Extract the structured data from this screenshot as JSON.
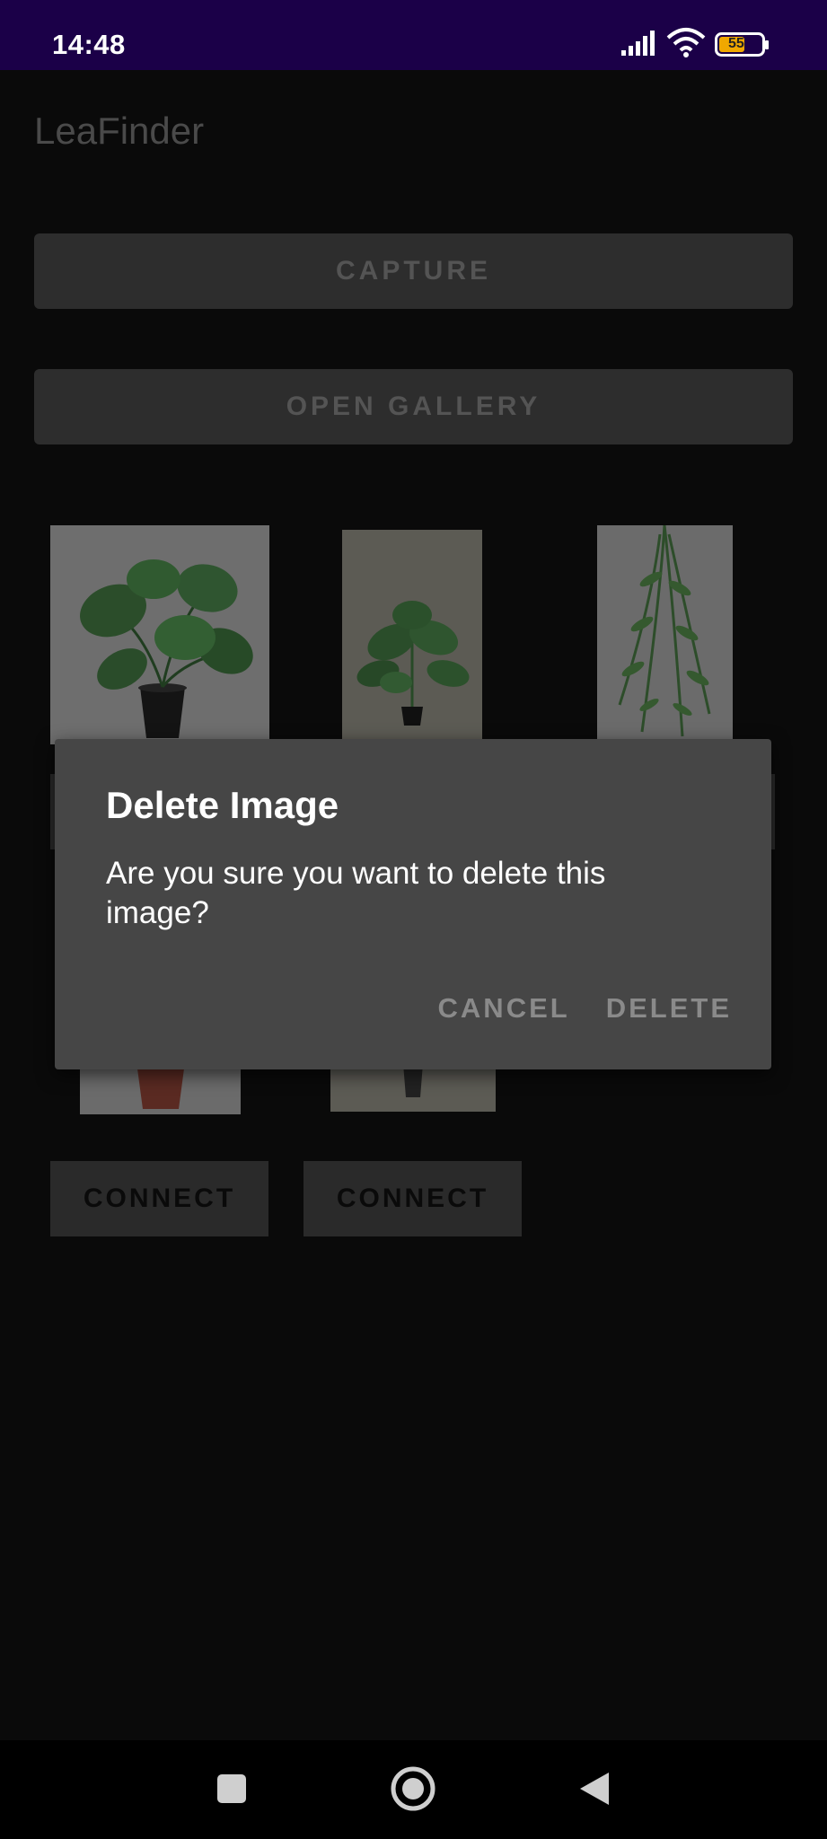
{
  "status_bar": {
    "time": "14:48",
    "battery": "55",
    "icons": [
      "signal-icon",
      "wifi-icon",
      "battery-icon"
    ]
  },
  "app": {
    "title": "LeaFinder",
    "capture_label": "CAPTURE",
    "gallery_label": "OPEN GALLERY"
  },
  "gallery": {
    "images": [
      "monstera-plant-image",
      "palm-plant-image",
      "hanging-fern-image",
      "terracotta-plant-image",
      "potted-plant-image"
    ],
    "connect_labels": [
      "CONNECT",
      "CONNECT"
    ]
  },
  "dialog": {
    "title": "Delete Image",
    "message": "Are you sure you want to delete this image?",
    "cancel_label": "CANCEL",
    "delete_label": "DELETE"
  },
  "nav": {
    "icons": [
      "recents-icon",
      "home-icon",
      "back-icon"
    ]
  },
  "colors": {
    "status_bar": "#1b0048",
    "dialog_bg": "#464646",
    "scrim_bg": "#0a0a0a"
  }
}
